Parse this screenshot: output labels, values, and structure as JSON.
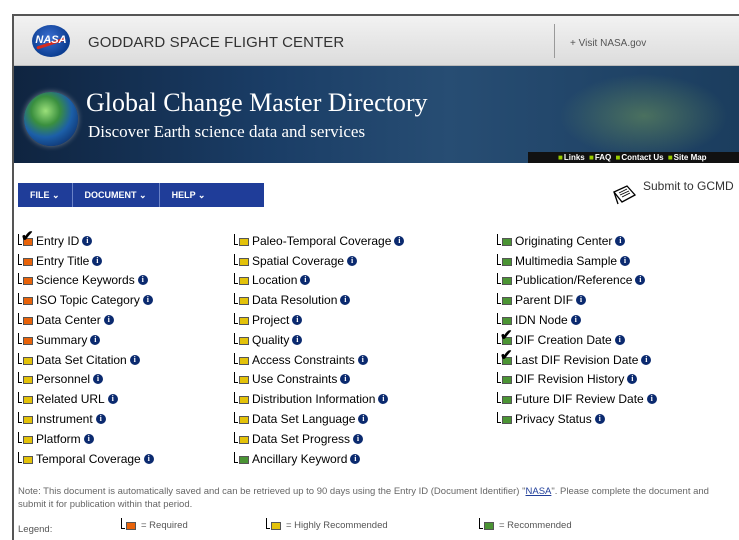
{
  "header": {
    "center_title": "GODDARD SPACE FLIGHT CENTER",
    "visit_link": "+ Visit NASA.gov",
    "logo_text": "NASA"
  },
  "banner": {
    "title": "Global Change Master Directory",
    "subtitle": "Discover Earth science data and services",
    "links": [
      "Links",
      "FAQ",
      "Contact Us",
      "Site Map"
    ]
  },
  "menu": {
    "items": [
      "FILE ⌄",
      "DOCUMENT ⌄",
      "HELP ⌄"
    ]
  },
  "submit": {
    "label": "Submit to GCMD"
  },
  "fields": {
    "col1": [
      {
        "label": "Entry ID",
        "priority": "required",
        "checked": true
      },
      {
        "label": "Entry Title",
        "priority": "required",
        "checked": false
      },
      {
        "label": "Science Keywords",
        "priority": "required",
        "checked": false
      },
      {
        "label": "ISO Topic Category",
        "priority": "required",
        "checked": false
      },
      {
        "label": "Data Center",
        "priority": "required",
        "checked": false
      },
      {
        "label": "Summary",
        "priority": "required",
        "checked": false
      },
      {
        "label": "Data Set Citation",
        "priority": "highly_recommended",
        "checked": false
      },
      {
        "label": "Personnel",
        "priority": "highly_recommended",
        "checked": false
      },
      {
        "label": "Related URL",
        "priority": "highly_recommended",
        "checked": false
      },
      {
        "label": "Instrument",
        "priority": "highly_recommended",
        "checked": false
      },
      {
        "label": "Platform",
        "priority": "highly_recommended",
        "checked": false
      },
      {
        "label": "Temporal Coverage",
        "priority": "highly_recommended",
        "checked": false
      }
    ],
    "col2": [
      {
        "label": "Paleo-Temporal Coverage",
        "priority": "highly_recommended",
        "checked": false
      },
      {
        "label": "Spatial Coverage",
        "priority": "highly_recommended",
        "checked": false
      },
      {
        "label": "Location",
        "priority": "highly_recommended",
        "checked": false
      },
      {
        "label": "Data Resolution",
        "priority": "highly_recommended",
        "checked": false
      },
      {
        "label": "Project",
        "priority": "highly_recommended",
        "checked": false
      },
      {
        "label": "Quality",
        "priority": "highly_recommended",
        "checked": false
      },
      {
        "label": "Access Constraints",
        "priority": "highly_recommended",
        "checked": false
      },
      {
        "label": "Use Constraints",
        "priority": "highly_recommended",
        "checked": false
      },
      {
        "label": "Distribution Information",
        "priority": "highly_recommended",
        "checked": false
      },
      {
        "label": "Data Set Language",
        "priority": "highly_recommended",
        "checked": false
      },
      {
        "label": "Data Set Progress",
        "priority": "highly_recommended",
        "checked": false
      },
      {
        "label": "Ancillary Keyword",
        "priority": "recommended",
        "checked": false
      }
    ],
    "col3": [
      {
        "label": "Originating Center",
        "priority": "recommended",
        "checked": false
      },
      {
        "label": "Multimedia Sample",
        "priority": "recommended",
        "checked": false
      },
      {
        "label": "Publication/Reference",
        "priority": "recommended",
        "checked": false
      },
      {
        "label": "Parent DIF",
        "priority": "recommended",
        "checked": false
      },
      {
        "label": "IDN Node",
        "priority": "recommended",
        "checked": false
      },
      {
        "label": "DIF Creation Date",
        "priority": "recommended",
        "checked": true
      },
      {
        "label": "Last DIF Revision Date",
        "priority": "recommended",
        "checked": true
      },
      {
        "label": "DIF Revision History",
        "priority": "recommended",
        "checked": false
      },
      {
        "label": "Future DIF Review Date",
        "priority": "recommended",
        "checked": false
      },
      {
        "label": "Privacy Status",
        "priority": "recommended",
        "checked": false
      }
    ]
  },
  "note": {
    "before": "Note: This document is automatically saved and can be retrieved up to 90 days using the Entry ID (Document Identifier) \"",
    "link": "NASA",
    "after": "\". Please complete the document and submit it for publication within that period."
  },
  "legend": {
    "label": "Legend:",
    "required": "= Required",
    "highly_recommended": "= Highly Recommended",
    "recommended": "= Recommended"
  },
  "colors": {
    "required": "#e8630a",
    "highly_recommended": "#e3c20a",
    "recommended": "#4b9434",
    "menu": "#1f3d99",
    "info_icon": "#0b2a6f"
  },
  "icons": {
    "info": "info-icon",
    "check": "check-icon",
    "submit": "submit-document-icon"
  }
}
